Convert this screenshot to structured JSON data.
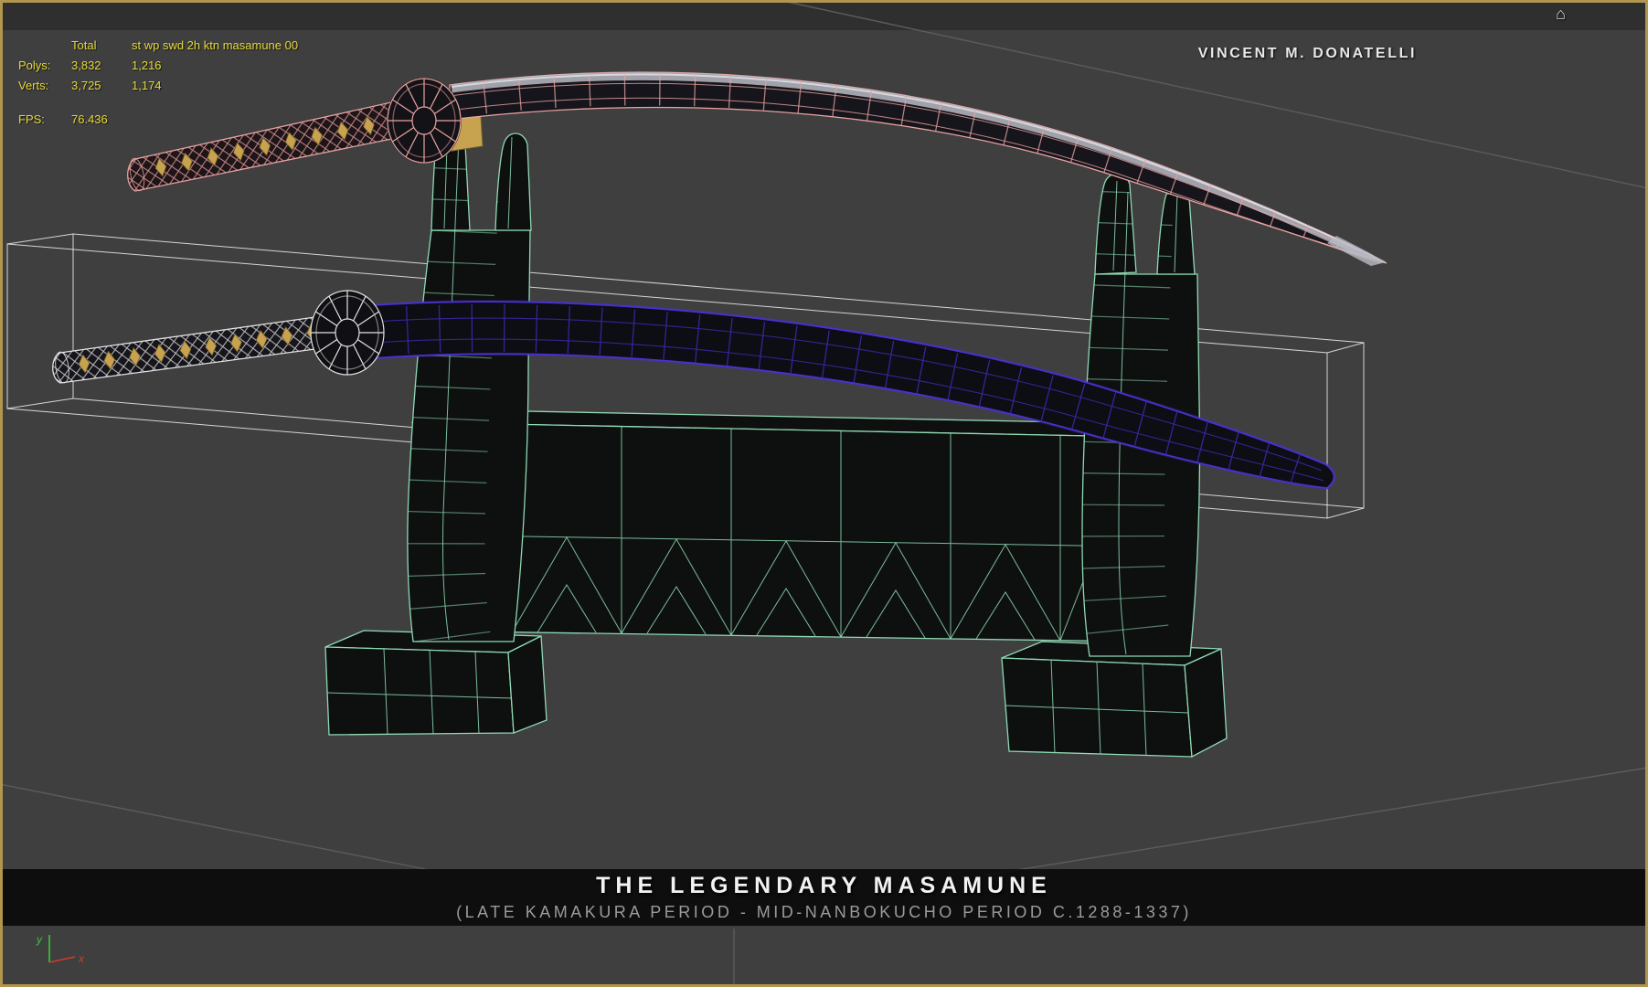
{
  "colors": {
    "frame-gold": "#b2954e",
    "viewport-bg": "#3f3f3f",
    "stats-yellow": "#e6d93a",
    "artist-white": "#e9e9e9",
    "title-white": "#f2f2f2",
    "subtitle-gray": "#9b9b9b",
    "ground-line": "#5c5c5c",
    "wire-pink": "#eaa3a3",
    "wire-purple": "#4a30d0",
    "wire-purple-dim": "#37289e",
    "wire-mint": "#8fd9b5",
    "wire-white": "#e2e2e2",
    "gold": "#c7a34f",
    "blade-light": "#b9bac2"
  },
  "stats": {
    "header": {
      "total": "Total",
      "object": "st wp swd 2h ktn masamune 00"
    },
    "rows": [
      {
        "label": "Polys:",
        "total": "3,832",
        "object": "1,216"
      },
      {
        "label": "Verts:",
        "total": "3,725",
        "object": "1,174"
      }
    ],
    "fps": {
      "label": "FPS:",
      "value": "76.436"
    }
  },
  "artist": "VINCENT M. DONATELLI",
  "banner": {
    "title": "THE LEGENDARY MASAMUNE",
    "subtitle": "(LATE KAMAKURA PERIOD - MID-NANBOKUCHO PERIOD C.1288-1337)"
  },
  "axis": {
    "x_label": "x",
    "y_label": "y"
  },
  "icons": {
    "home": "⌂"
  }
}
